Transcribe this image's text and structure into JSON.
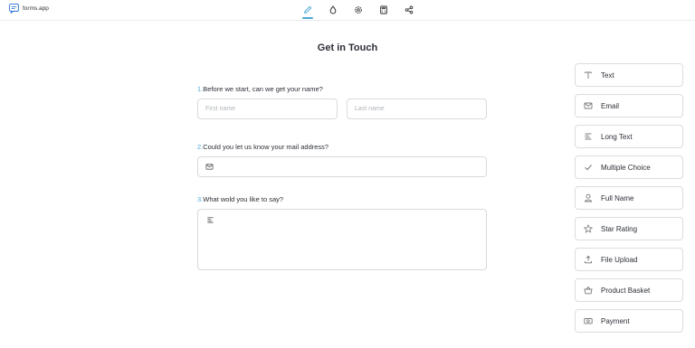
{
  "brand": {
    "name": "forms.app",
    "icon": "forms-app-logo"
  },
  "toolbar": [
    {
      "icon": "pencil-icon",
      "active": true
    },
    {
      "icon": "droplet-icon",
      "active": false
    },
    {
      "icon": "gear-icon",
      "active": false
    },
    {
      "icon": "calculator-icon",
      "active": false
    },
    {
      "icon": "share-icon",
      "active": false
    }
  ],
  "colors": {
    "accent": "#4aa9d6",
    "border": "#d6dade",
    "text": "#2b2f36"
  },
  "form": {
    "title": "Get in Touch",
    "questions": [
      {
        "number": "1.",
        "label": "Before we start, can we get your name?",
        "first_name_placeholder": "First name",
        "last_name_placeholder": "Last name",
        "first_name_value": "",
        "last_name_value": ""
      },
      {
        "number": "2.",
        "label": "Could you let us know your mail address?",
        "icon": "mail-icon",
        "value": ""
      },
      {
        "number": "3.",
        "label": "What wold you like to say?",
        "icon": "long-text-icon",
        "value": ""
      }
    ]
  },
  "palette": [
    {
      "label": "Text",
      "icon": "text-icon"
    },
    {
      "label": "Email",
      "icon": "mail-icon"
    },
    {
      "label": "Long Text",
      "icon": "long-text-icon"
    },
    {
      "label": "Multiple Choice",
      "icon": "checkmark-icon"
    },
    {
      "label": "Full Name",
      "icon": "user-icon"
    },
    {
      "label": "Star Rating",
      "icon": "star-icon"
    },
    {
      "label": "File Upload",
      "icon": "upload-icon"
    },
    {
      "label": "Product Basket",
      "icon": "basket-icon"
    },
    {
      "label": "Payment",
      "icon": "payment-icon"
    }
  ]
}
